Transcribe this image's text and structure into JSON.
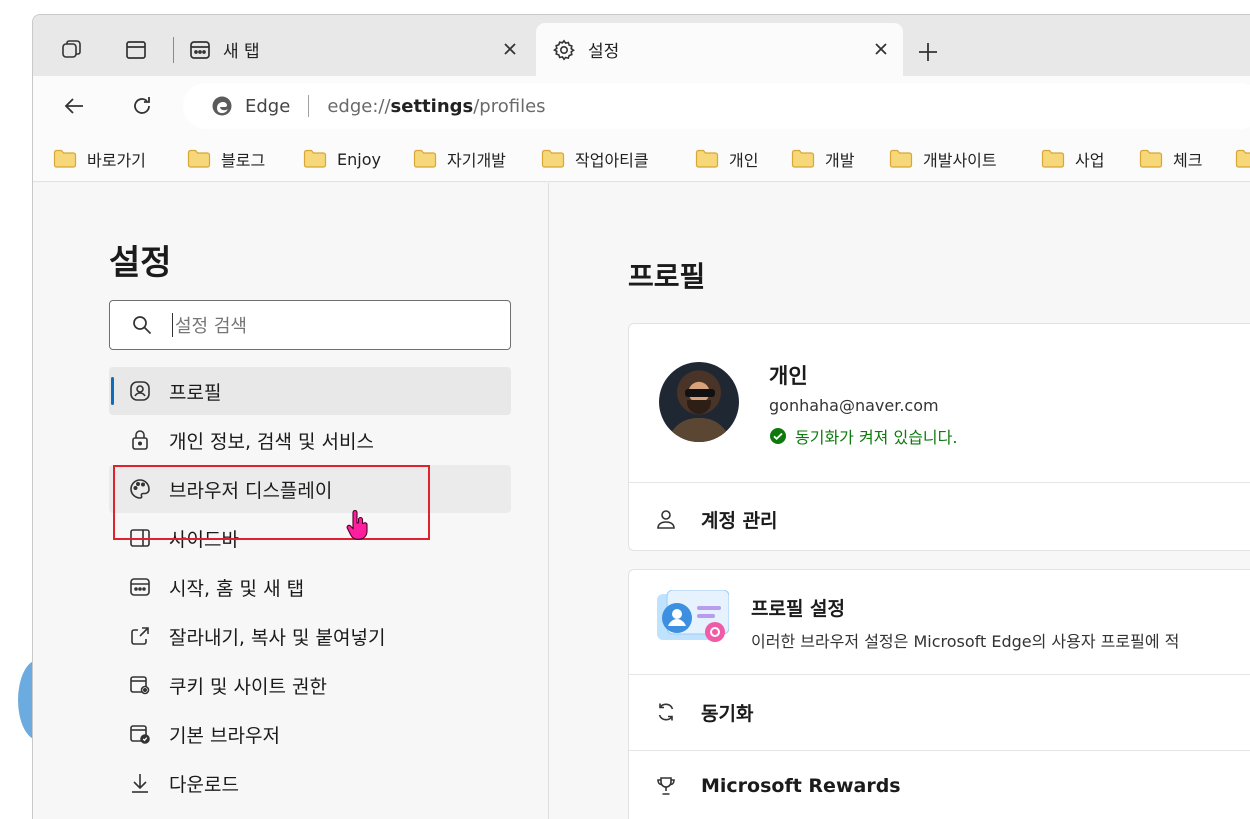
{
  "tabs": {
    "inactive_title": "새 탭",
    "active_title": "설정"
  },
  "address": {
    "site_label": "Edge",
    "url_scheme": "edge://",
    "url_host": "settings",
    "url_path": "/profiles"
  },
  "favorites": [
    {
      "label": "바로가기"
    },
    {
      "label": "블로그"
    },
    {
      "label": "Enjoy"
    },
    {
      "label": "자기개발"
    },
    {
      "label": "작업아티클"
    },
    {
      "label": "개인"
    },
    {
      "label": "개발"
    },
    {
      "label": "개발사이트"
    },
    {
      "label": "사업"
    },
    {
      "label": "체크"
    }
  ],
  "sidebar": {
    "title": "설정",
    "search_placeholder": "설정 검색",
    "items": [
      {
        "label": "프로필",
        "icon": "profile-icon",
        "selected": true
      },
      {
        "label": "개인 정보, 검색 및 서비스",
        "icon": "lock-icon"
      },
      {
        "label": "브라우저 디스플레이",
        "icon": "palette-icon",
        "hovered": true
      },
      {
        "label": "사이드바",
        "icon": "sidebar-icon"
      },
      {
        "label": "시작, 홈 및 새 탭",
        "icon": "start-home-icon"
      },
      {
        "label": "잘라내기, 복사 및 붙여넣기",
        "icon": "share-icon"
      },
      {
        "label": "쿠키 및 사이트 권한",
        "icon": "cookie-icon"
      },
      {
        "label": "기본 브라우저",
        "icon": "default-browser-icon"
      },
      {
        "label": "다운로드",
        "icon": "download-icon"
      }
    ]
  },
  "main": {
    "title": "프로필",
    "profile": {
      "name": "개인",
      "email": "gonhaha@naver.com",
      "sync_status": "동기화가 켜져 있습니다."
    },
    "account_manage_label": "계정 관리",
    "profile_settings": {
      "title": "프로필 설정",
      "description": "이러한 브라우저 설정은 Microsoft Edge의 사용자 프로필에 적"
    },
    "sync_label": "동기화",
    "rewards_label": "Microsoft Rewards"
  },
  "colors": {
    "accent": "#0f6cbd",
    "sync_green": "#0e7a0d",
    "highlight_red": "#e0212f"
  }
}
